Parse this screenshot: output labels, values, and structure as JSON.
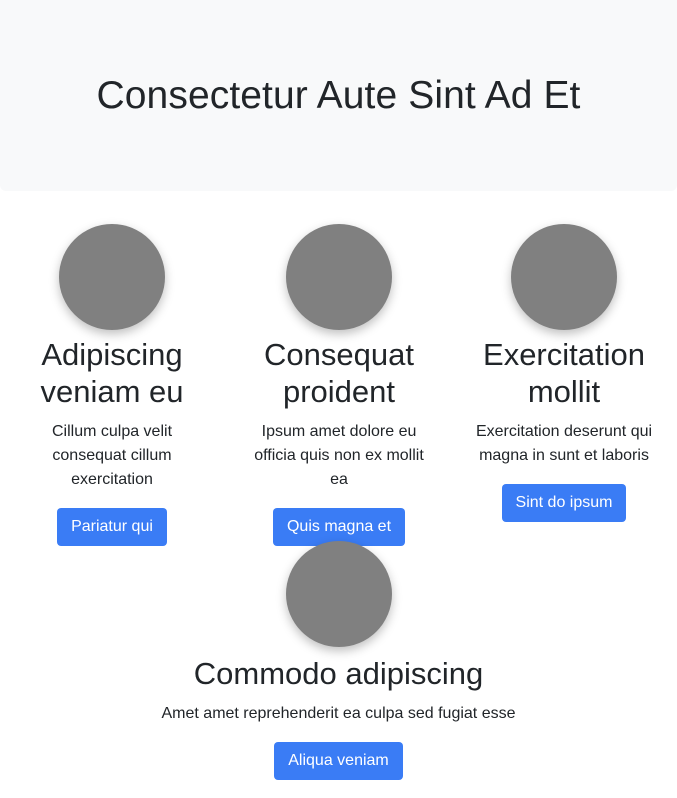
{
  "hero": {
    "title": "Consectetur Aute Sint Ad Et"
  },
  "cards": [
    {
      "title": "Adipiscing veniam eu",
      "text": "Cillum culpa velit consequat cillum exercitation",
      "button_label": "Pariatur qui"
    },
    {
      "title": "Consequat proident",
      "text": "Ipsum amet dolore eu officia quis non ex mollit ea",
      "button_label": "Quis magna et"
    },
    {
      "title": "Exercitation mollit",
      "text": "Exercitation deserunt qui magna in sunt et laboris",
      "button_label": "Sint do ipsum"
    },
    {
      "title": "Commodo adipiscing",
      "text": "Amet amet reprehenderit ea culpa sed fugiat esse",
      "button_label": "Aliqua veniam"
    }
  ],
  "colors": {
    "hero_background": "#f8f9fa",
    "avatar": "#808080",
    "button": "#3a7cf5",
    "text": "#212529"
  }
}
